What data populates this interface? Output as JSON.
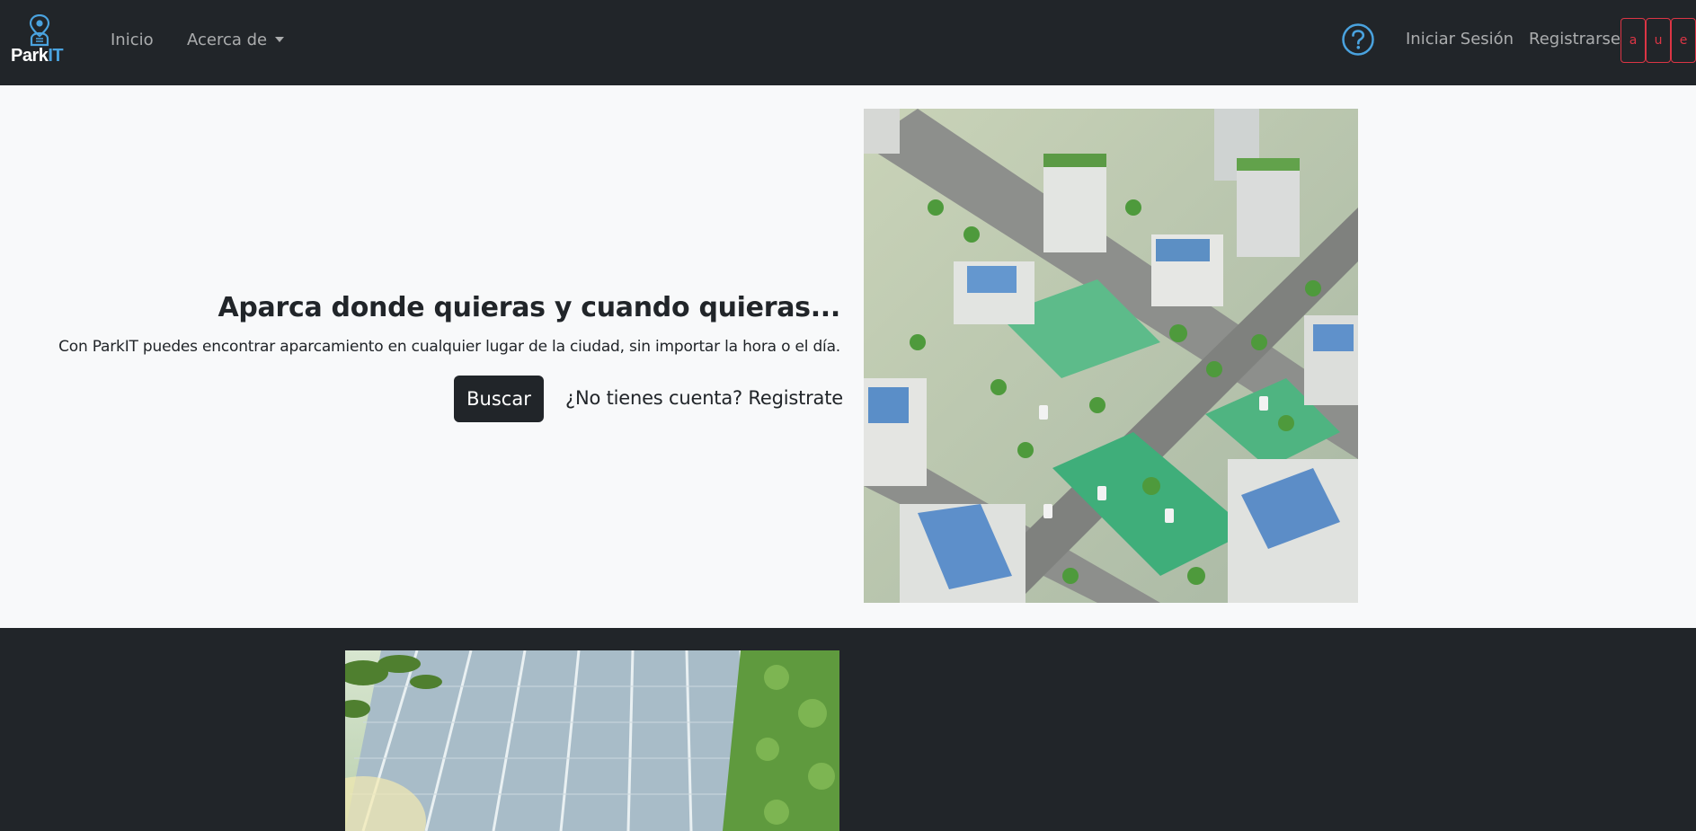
{
  "brand": {
    "park": "Park",
    "it": "IT"
  },
  "nav": {
    "inicio": "Inicio",
    "acerca": "Acerca de",
    "login": "Iniciar Sesión",
    "register": "Registrarse",
    "chars": [
      "a",
      "u",
      "e"
    ]
  },
  "hero": {
    "title": "Aparca donde quieras y cuando quieras...",
    "subtitle": "Con ParkIT puedes encontrar aparcamiento en cualquier lugar de la ciudad, sin importar la hora o el día.",
    "search_button": "Buscar",
    "register_link": "¿No tienes cuenta? Registrate"
  },
  "colors": {
    "navbar_bg": "#212529",
    "page_bg": "#f8f9fa",
    "accent_blue": "#4aa3df",
    "danger": "#dc3545"
  },
  "icons": {
    "logo": "parking-user-pin-icon",
    "help": "question-circle-icon"
  }
}
